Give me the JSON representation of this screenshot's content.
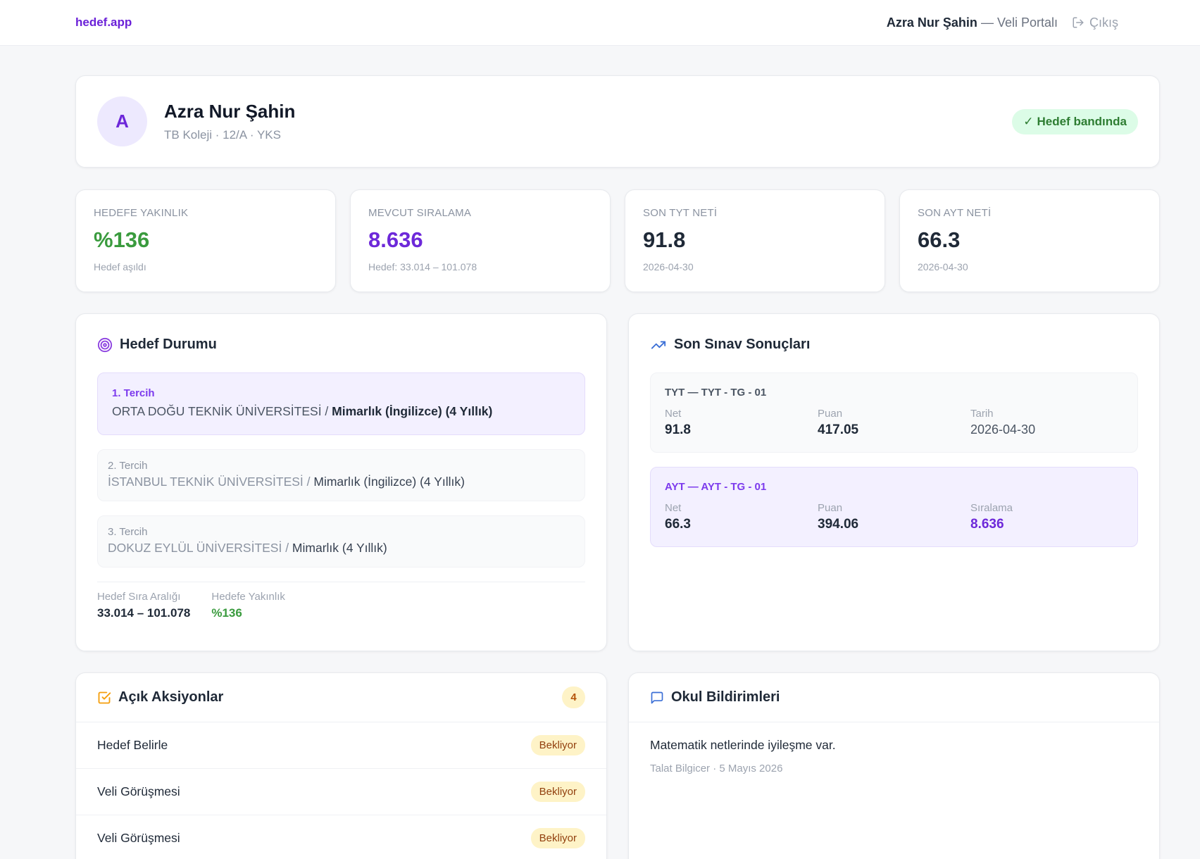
{
  "brand": "hedef.app",
  "header": {
    "user": "Azra Nur Şahin",
    "portal": "— Veli Portalı",
    "logout": "Çıkış"
  },
  "profile": {
    "initial": "A",
    "name": "Azra Nur Şahin",
    "sub": "TB Koleji · 12/A · YKS",
    "status": "Hedef bandında"
  },
  "stats": [
    {
      "label": "HEDEFE YAKINLIK",
      "value": "%136",
      "sub": "Hedef aşıldı",
      "color": "#3a9b3e"
    },
    {
      "label": "MEVCUT SIRALAMA",
      "value": "8.636",
      "sub": "Hedef: 33.014 – 101.078",
      "color": "#6d28d9"
    },
    {
      "label": "SON TYT NETİ",
      "value": "91.8",
      "sub": "2026-04-30",
      "color": "#1f2937"
    },
    {
      "label": "SON AYT NETİ",
      "value": "66.3",
      "sub": "2026-04-30",
      "color": "#1f2937"
    }
  ],
  "goal": {
    "title": "Hedef Durumu",
    "prefs": [
      {
        "num": "1. Tercih",
        "uni": "ORTA DOĞU TEKNİK ÜNİVERSİTESİ",
        "sep": " / ",
        "dept": "Mimarlık (İngilizce) (4 Yıllık)"
      },
      {
        "num": "2. Tercih",
        "uni": "İSTANBUL TEKNİK ÜNİVERSİTESİ",
        "sep": " / ",
        "dept": "Mimarlık (İngilizce) (4 Yıllık)"
      },
      {
        "num": "3. Tercih",
        "uni": "DOKUZ EYLÜL ÜNİVERSİTESİ",
        "sep": " / ",
        "dept": "Mimarlık (4 Yıllık)"
      }
    ],
    "range_label": "Hedef Sıra Aralığı",
    "range_value": "33.014 – 101.078",
    "proximity_label": "Hedefe Yakınlık",
    "proximity_value": "%136"
  },
  "exams": {
    "title": "Son Sınav Sonuçları",
    "tyt": {
      "title": "TYT — TYT - TG - 01",
      "net_label": "Net",
      "net": "91.8",
      "score_label": "Puan",
      "score": "417.05",
      "date_label": "Tarih",
      "date": "2026-04-30"
    },
    "ayt": {
      "title": "AYT — AYT - TG - 01",
      "net_label": "Net",
      "net": "66.3",
      "score_label": "Puan",
      "score": "394.06",
      "rank_label": "Sıralama",
      "rank": "8.636"
    }
  },
  "actions": {
    "title": "Açık Aksiyonlar",
    "count": "4",
    "items": [
      {
        "label": "Hedef Belirle",
        "status": "Bekliyor"
      },
      {
        "label": "Veli Görüşmesi",
        "status": "Bekliyor"
      },
      {
        "label": "Veli Görüşmesi",
        "status": "Bekliyor"
      }
    ]
  },
  "notices": {
    "title": "Okul Bildirimleri",
    "text": "Matematik netlerinde iyileşme var.",
    "meta": "Talat Bilgicer · 5 Mayıs 2026"
  },
  "colors": {
    "accent": "#6d28d9",
    "success": "#3a9b3e",
    "warning_bg": "#fef3c7"
  }
}
